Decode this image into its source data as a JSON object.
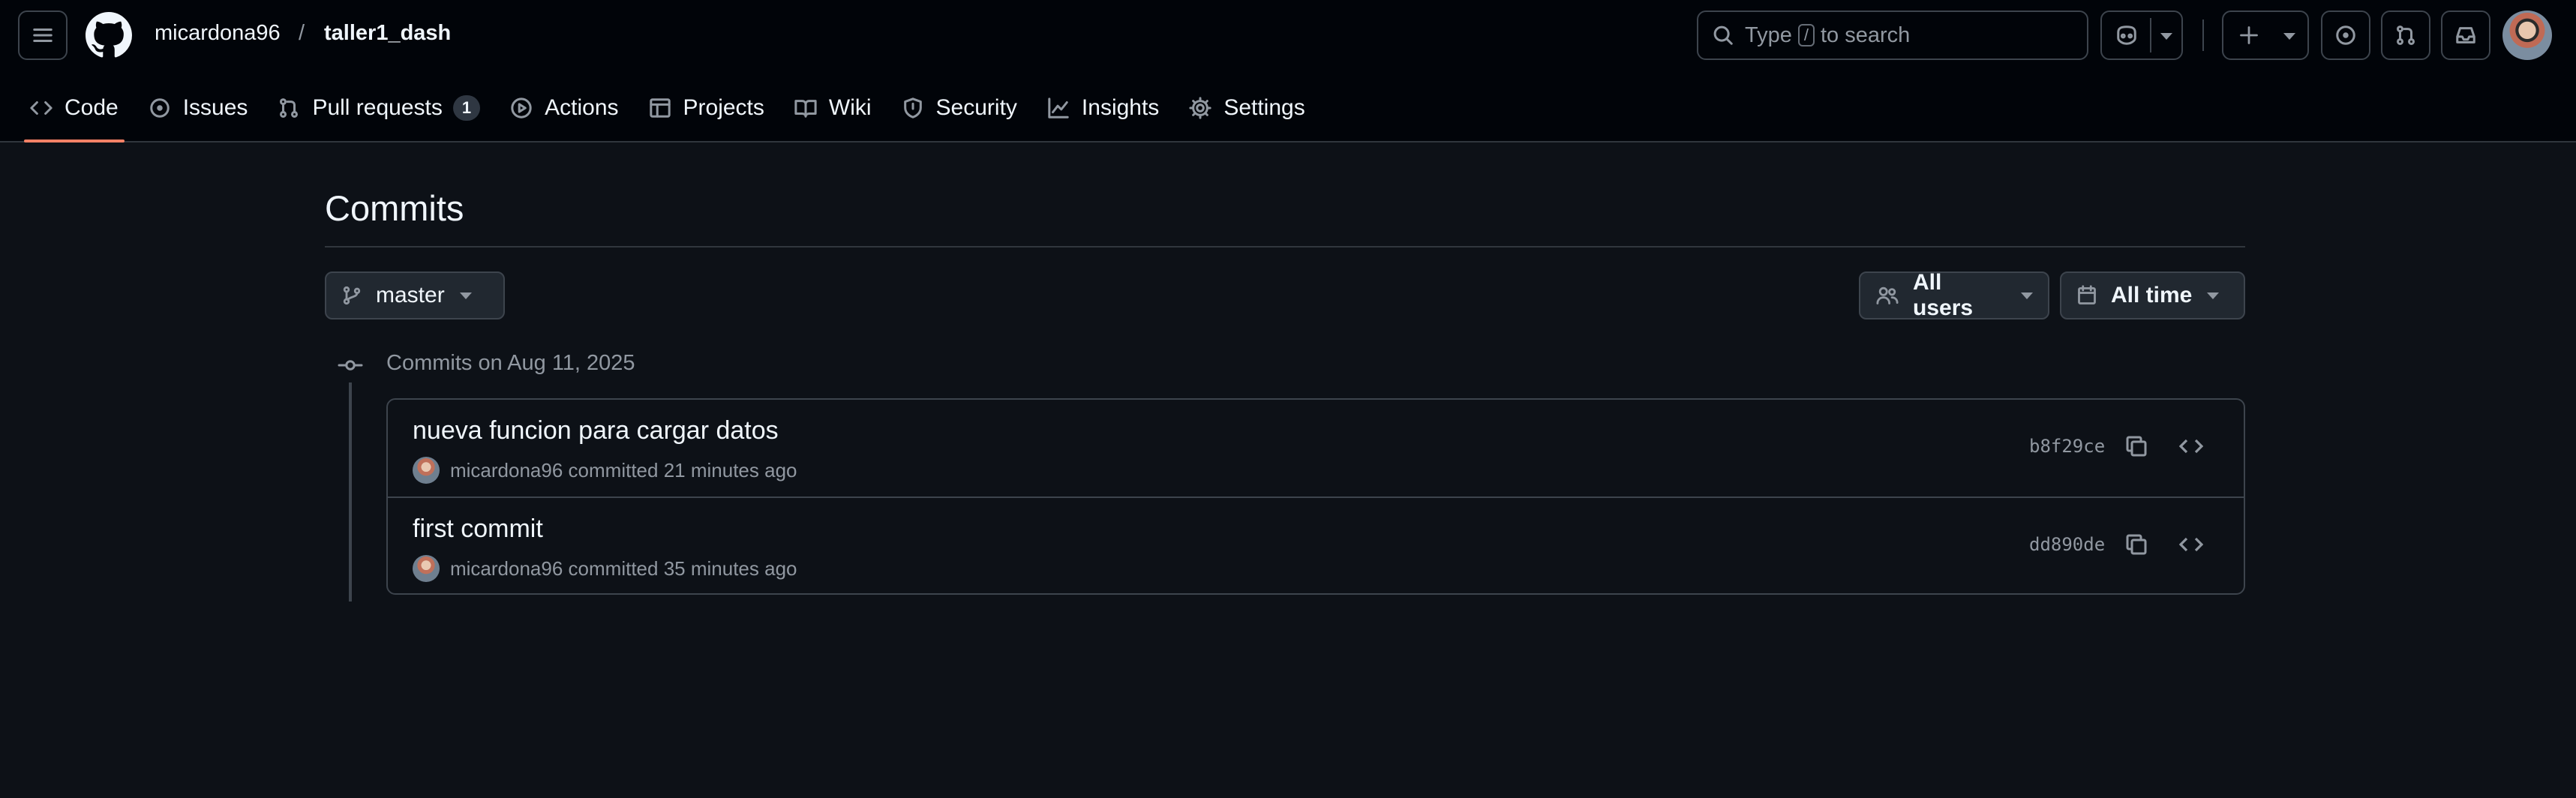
{
  "header": {
    "owner": "micardona96",
    "separator": "/",
    "repo": "taller1_dash",
    "search": {
      "prefix": "Type",
      "key": "/",
      "suffix": "to search"
    }
  },
  "tabs": [
    {
      "label": "Code",
      "icon": "code-icon"
    },
    {
      "label": "Issues",
      "icon": "issue-icon"
    },
    {
      "label": "Pull requests",
      "icon": "pull-request-icon",
      "count": "1"
    },
    {
      "label": "Actions",
      "icon": "play-icon"
    },
    {
      "label": "Projects",
      "icon": "table-icon"
    },
    {
      "label": "Wiki",
      "icon": "book-icon"
    },
    {
      "label": "Security",
      "icon": "shield-icon"
    },
    {
      "label": "Insights",
      "icon": "graph-icon"
    },
    {
      "label": "Settings",
      "icon": "gear-icon"
    }
  ],
  "page": {
    "title": "Commits",
    "branch": "master",
    "users_filter": "All users",
    "time_filter": "All time",
    "group_title": "Commits on Aug 11, 2025"
  },
  "commits": [
    {
      "message": "nueva funcion para cargar datos",
      "author": "micardona96",
      "action": "committed",
      "time": "21 minutes ago",
      "sha": "b8f29ce"
    },
    {
      "message": "first commit",
      "author": "micardona96",
      "action": "committed",
      "time": "35 minutes ago",
      "sha": "dd890de"
    }
  ],
  "colors": {
    "background": "#0d1117",
    "header": "#010409",
    "border": "#3d444d",
    "accent": "#f78166",
    "muted": "#9198a1"
  }
}
